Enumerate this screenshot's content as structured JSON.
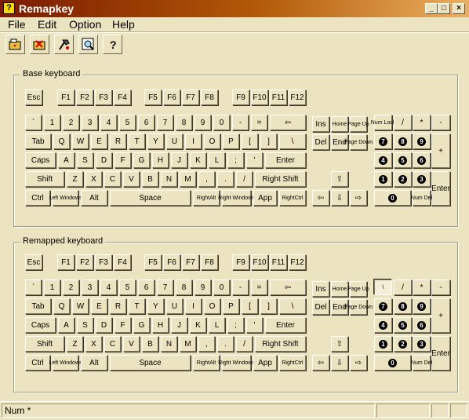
{
  "window": {
    "title": "Remapkey",
    "app_icon_glyph": "?",
    "minimize_glyph": "_",
    "maximize_glyph": "□",
    "close_glyph": "×"
  },
  "menu": [
    "File",
    "Edit",
    "Option",
    "Help"
  ],
  "toolbar": [
    "open-file-icon",
    "restore-icon",
    "remap-tool-icon",
    "preview-icon",
    "help-icon"
  ],
  "base_title": "Base keyboard",
  "remap_title": "Remapped keyboard",
  "keys": {
    "esc": "Esc",
    "f1": "F1",
    "f2": "F2",
    "f3": "F3",
    "f4": "F4",
    "f5": "F5",
    "f6": "F6",
    "f7": "F7",
    "f8": "F8",
    "f9": "F9",
    "f10": "F10",
    "f11": "F11",
    "f12": "F12",
    "grave": "`",
    "d1": "1",
    "d2": "2",
    "d3": "3",
    "d4": "4",
    "d5": "5",
    "d6": "6",
    "d7": "7",
    "d8": "8",
    "d9": "9",
    "d0": "0",
    "minus": "-",
    "equal": "=",
    "bksp": "⇦",
    "tab": "Tab",
    "q": "Q",
    "w": "W",
    "e": "E",
    "r": "R",
    "t": "T",
    "y": "Y",
    "u": "U",
    "i": "I",
    "o": "O",
    "p": "P",
    "lbr": "[",
    "rbr": "]",
    "bsl": "\\",
    "caps": "Caps",
    "a": "A",
    "s": "S",
    "d": "D",
    "f": "F",
    "g": "G",
    "h": "H",
    "j": "J",
    "k": "K",
    "l": "L",
    "semi": ";",
    "quote": "'",
    "enter": "Enter",
    "lshift": "Shift",
    "z": "Z",
    "x": "X",
    "c": "C",
    "v": "V",
    "b": "B",
    "n": "N",
    "m": "M",
    "comma": ",",
    "period": ".",
    "slash": "/",
    "rshift": "Right Shift",
    "ctrl": "Ctrl",
    "lwin": "Left Windows",
    "alt": "Alt",
    "space": "Space",
    "ralt": "RightAlt",
    "rwin": "Right Windows",
    "app": "App",
    "rctrl": "RightCtrl",
    "ins": "Ins",
    "home": "Home",
    "pgup": "Page Up",
    "del": "Del",
    "end": "End",
    "pgdn": "Page Down",
    "up": "⇧",
    "left": "⇦",
    "down": "⇩",
    "right": "⇨",
    "numlock": "Num Lock",
    "kpdiv": "/",
    "kpmul": "*",
    "kpsub": "-",
    "kpadd": "+",
    "kpenter": "Enter",
    "kp7": "7",
    "kp8": "8",
    "kp9": "9",
    "kp4": "4",
    "kp5": "5",
    "kp6": "6",
    "kp1": "1",
    "kp2": "2",
    "kp3": "3",
    "kp0": "0",
    "kpdel": "Num Del"
  },
  "remapped_overrides": {
    "numlock": "\\"
  },
  "status": {
    "panel1": "Num *",
    "panel2": "",
    "panel3": "",
    "panel4": ""
  }
}
